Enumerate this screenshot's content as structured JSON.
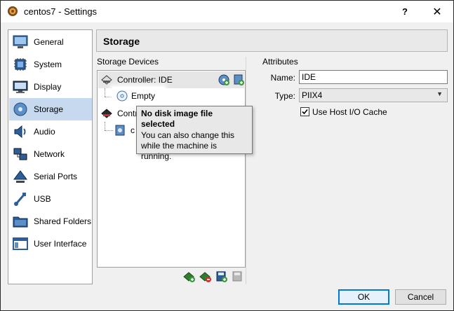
{
  "window": {
    "title": "centos7 - Settings",
    "help_glyph": "?",
    "close_glyph": "✕"
  },
  "sidebar": {
    "selected": "Storage",
    "items": [
      {
        "label": "General",
        "icon": "general-icon"
      },
      {
        "label": "System",
        "icon": "system-chip-icon"
      },
      {
        "label": "Display",
        "icon": "display-monitor-icon"
      },
      {
        "label": "Storage",
        "icon": "storage-disk-icon"
      },
      {
        "label": "Audio",
        "icon": "audio-speaker-icon"
      },
      {
        "label": "Network",
        "icon": "network-icon"
      },
      {
        "label": "Serial Ports",
        "icon": "serial-port-icon"
      },
      {
        "label": "USB",
        "icon": "usb-icon"
      },
      {
        "label": "Shared Folders",
        "icon": "shared-folder-icon"
      },
      {
        "label": "User Interface",
        "icon": "user-interface-icon"
      }
    ]
  },
  "header": {
    "title": "Storage"
  },
  "storage_devices": {
    "label": "Storage Devices",
    "controller_ide": "Controller: IDE",
    "empty_item": "Empty",
    "controller_sata_partial": "Contr",
    "sata_disk_partial": "c"
  },
  "tooltip": {
    "title": "No disk image file selected",
    "body_line1": "You can also change this",
    "body_line2": "while the machine is",
    "body_line3": "running."
  },
  "attributes": {
    "label": "Attributes",
    "name_label": "Name:",
    "name_value": "IDE",
    "type_label": "Type:",
    "type_value": "PIIX4",
    "host_io_cache_label": "Use Host I/O Cache",
    "host_io_cache_checked": true
  },
  "buttons": {
    "ok": "OK",
    "cancel": "Cancel"
  },
  "colors": {
    "accent": "#0078d7",
    "selection": "#c6d9ef",
    "add_green": "#3c9a3c",
    "remove_red": "#c83232"
  }
}
